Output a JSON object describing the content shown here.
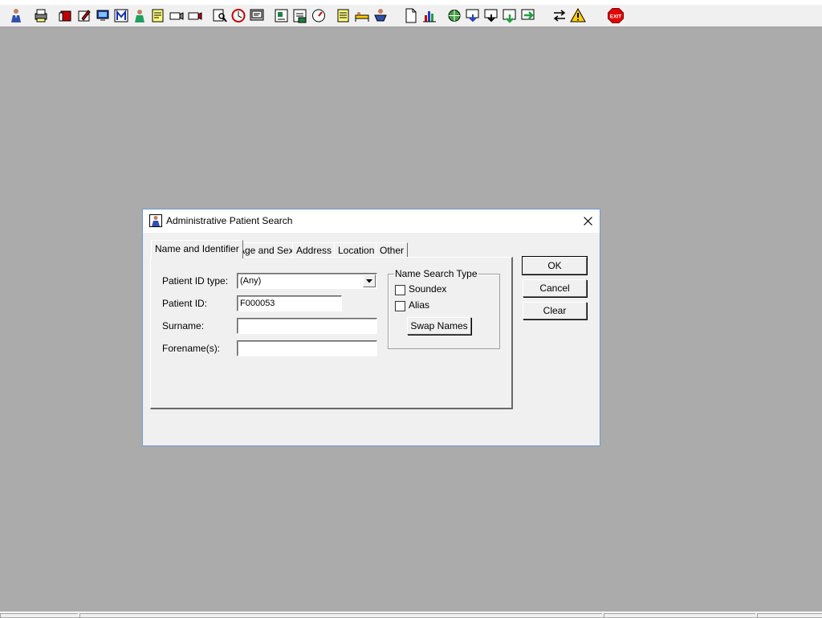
{
  "toolbar": {
    "icons": [
      "patient-icon",
      "print-icon",
      "book-icon",
      "edit-icon",
      "monitor-icon",
      "m-icon",
      "doctor-icon",
      "note-icon",
      "camera-icon",
      "camera-icon",
      "search-icon",
      "clock-icon",
      "screen-icon",
      "chart-icon",
      "report-icon",
      "gauge-icon",
      "notes-icon",
      "bed-icon",
      "transfer-icon",
      "document-icon",
      "bar-chart-icon",
      "globe-icon",
      "download-icon",
      "inbox-icon",
      "flag-icon",
      "arrow-icon",
      "swap-icon",
      "warning-icon",
      "exit-icon"
    ],
    "exit_label": "EXIT"
  },
  "dialog": {
    "title": "Administrative Patient Search",
    "tabs": [
      "Name and Identifier",
      "Age and Sex",
      "Address",
      "Location",
      "Other"
    ],
    "active_tab": "Name and Identifier",
    "fields": {
      "patient_id_type_label": "Patient ID type:",
      "patient_id_type_value": "(Any)",
      "patient_id_label": "Patient ID:",
      "patient_id_value": "F000053",
      "surname_label": "Surname:",
      "surname_value": "",
      "forename_label": "Forename(s):",
      "forename_value": ""
    },
    "name_search_type": {
      "legend": "Name Search Type",
      "soundex_label": "Soundex",
      "soundex_checked": false,
      "alias_label": "Alias",
      "alias_checked": false,
      "swap_names_label": "Swap Names"
    },
    "buttons": {
      "ok": "OK",
      "cancel": "Cancel",
      "clear": "Clear"
    }
  }
}
